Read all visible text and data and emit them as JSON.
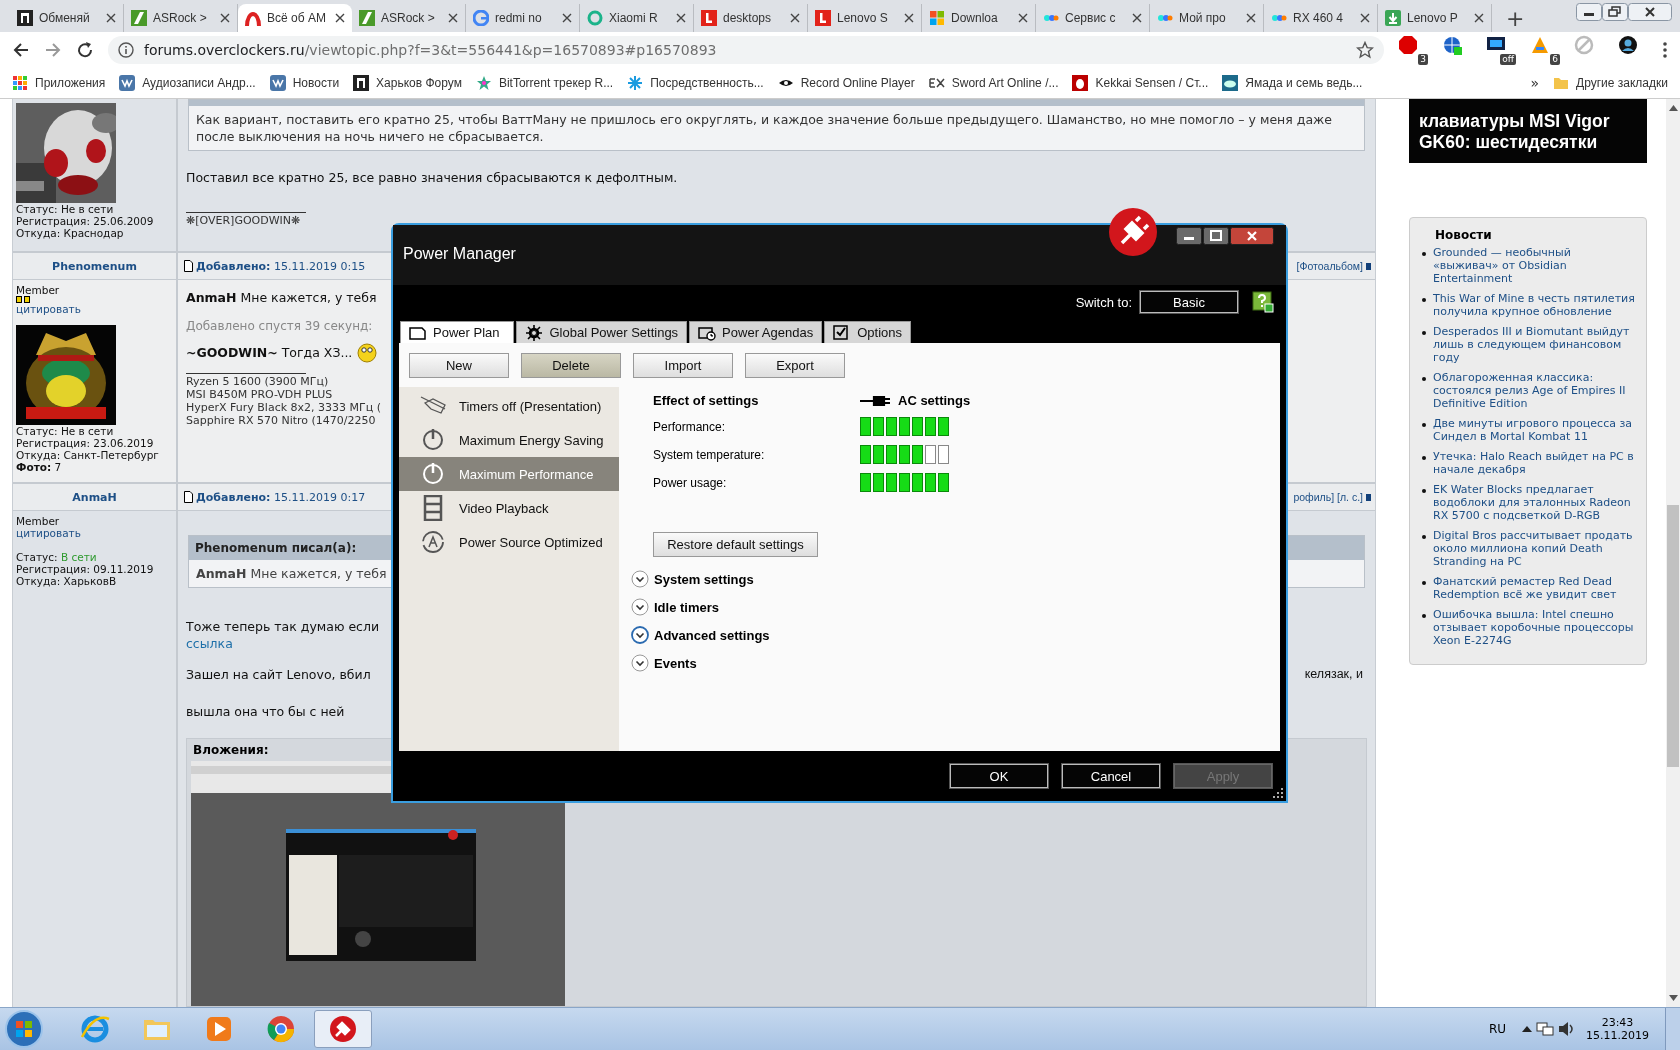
{
  "browser": {
    "tabs": [
      {
        "title": "Обменяй",
        "kind": "dark",
        "selected": false
      },
      {
        "title": "ASRock >",
        "kind": "green",
        "selected": false
      },
      {
        "title": "Всё об AM",
        "kind": "arc",
        "selected": true
      },
      {
        "title": "ASRock >",
        "kind": "green",
        "selected": false
      },
      {
        "title": "redmi no",
        "kind": "g",
        "selected": false
      },
      {
        "title": "Xiaomi R",
        "kind": "ring",
        "selected": false
      },
      {
        "title": "desktops",
        "kind": "red",
        "selected": false
      },
      {
        "title": "Lenovo S",
        "kind": "red",
        "selected": false
      },
      {
        "title": "Downloa",
        "kind": "win",
        "selected": false
      },
      {
        "title": "Сервис с",
        "kind": "dots",
        "selected": false
      },
      {
        "title": "Мой про",
        "kind": "dots",
        "selected": false
      },
      {
        "title": "RX 460 4",
        "kind": "dots",
        "selected": false
      },
      {
        "title": "Lenovo P",
        "kind": "down",
        "selected": false
      }
    ],
    "new_tab": "+",
    "address": {
      "domain": "forums.overclockers.ru",
      "path": "/viewtopic.php?f=3&t=556441&p=16570893#p16570893"
    },
    "extensions": [
      {
        "kind": "stop",
        "badge": "3"
      },
      {
        "kind": "globe"
      },
      {
        "kind": "monitor",
        "badge": "off"
      },
      {
        "kind": "a",
        "badge": "6"
      },
      {
        "kind": "grey"
      },
      {
        "kind": "avatar"
      }
    ],
    "bookmarks": [
      {
        "label": "Приложения",
        "kind": "grid"
      },
      {
        "label": "Аудиозаписи Андр...",
        "kind": "vk"
      },
      {
        "label": "Новости",
        "kind": "vk"
      },
      {
        "label": "Харьков Форум",
        "kind": "dark"
      },
      {
        "label": "BitTorrent трекер R...",
        "kind": "star"
      },
      {
        "label": "Посредственность...",
        "kind": "spark"
      },
      {
        "label": "Record Online Player",
        "kind": "eye"
      },
      {
        "label": "Sword Art Online /...",
        "kind": "ex"
      },
      {
        "label": "Kekkai Sensen / Ст...",
        "kind": "drop"
      },
      {
        "label": "Ямада и семь ведь...",
        "kind": "cloud"
      }
    ],
    "more": "»",
    "other_bookmarks": "Другие закладки"
  },
  "forum": {
    "posts": [
      {
        "user": {
          "fields": [
            {
              "label": "Статус:",
              "value": "Не в сети",
              "kind": "status",
              "online": false
            },
            {
              "label": "Регистрация:",
              "value": "25.06.2009",
              "kind": "plain"
            },
            {
              "label": "Откуда:",
              "value": "Краснодар",
              "kind": "plain"
            }
          ]
        },
        "body": [
          {
            "kind": "quote",
            "text": "Как вариант, поставить его кратно 25, чтобы ВаттМану не пришлось его округлять, и каждое значение больше предыдущего. Шаманство, но мне помогло – у меня даже после выключения на ночь ничего не сбрасывается."
          },
          {
            "kind": "para",
            "text": "Поставил все кратно 25, все равно значения сбрасываются к дефолтным."
          },
          {
            "kind": "signature",
            "lines": [
              "❋[OVER]GOODWIN❋"
            ]
          }
        ]
      },
      {
        "header": {
          "author": "Phenomenum",
          "date_label": "Добавлено:",
          "date": "15.11.2019 0:15",
          "links": "[Фотоальбом]"
        },
        "user": {
          "rank": "Member",
          "rank_badge": true,
          "quote_link": "цитировать",
          "fields": [
            {
              "label": "Статус:",
              "value": "Не в сети",
              "kind": "status",
              "online": false
            },
            {
              "label": "Регистрация:",
              "value": "23.06.2019",
              "kind": "plain"
            },
            {
              "label": "Откуда:",
              "value": "Санкт-Петербург",
              "kind": "plain"
            },
            {
              "label": "Фото:",
              "value": "7",
              "kind": "bold"
            }
          ]
        },
        "body": [
          {
            "kind": "big",
            "text": "**AnmaH** Мне кажется, у тебя"
          },
          {
            "kind": "added",
            "text": "Добавлено спустя 39 секунд:"
          },
          {
            "kind": "big",
            "text": "**~GOODWIN~** Тогда ХЗ...",
            "smiley": true
          },
          {
            "kind": "signature",
            "lines": [
              "Ryzen 5 1600 (3900 МГц)",
              "MSI B450M PRO-VDH PLUS",
              "HyperX Fury Black 8x2, 3333 МГц (",
              "Sapphire RX 570 Nitro (1470/2250"
            ]
          }
        ]
      },
      {
        "header": {
          "author": "AnmaH",
          "date_label": "Добавлено:",
          "date": "15.11.2019 0:17",
          "links": "рофиль] [л. с.]"
        },
        "user": {
          "rank": "Member",
          "quote_link": "цитировать",
          "fields": [
            {
              "label": "Статус:",
              "value": "В сети",
              "kind": "status",
              "online": true
            },
            {
              "label": "Регистрация:",
              "value": "09.11.2019",
              "kind": "plain"
            },
            {
              "label": "Откуда:",
              "value": "ХарьковВ",
              "kind": "plain"
            }
          ]
        },
        "body": [
          {
            "kind": "quote",
            "header": "Phenomenum писал(а):",
            "text": "**AnmaH** Мне кажется, у тебя"
          },
          {
            "kind": "para",
            "text": "Тоже теперь так думаю если"
          },
          {
            "kind": "link",
            "text": "ссылка"
          },
          {
            "kind": "split",
            "left": "Зашел на сайт Lenovo, вбил",
            "right": "келязак, и"
          },
          {
            "kind": "para",
            "text": "вышла она что бы с ней"
          },
          {
            "kind": "attachments",
            "title": "Вложения:"
          }
        ]
      }
    ]
  },
  "sidebar": {
    "banner": "клавиатуры MSI Vigor GK60: шестидесятки",
    "news": {
      "title": "Новости",
      "items": [
        "Grounded — необычный «выживач» от Obsidian Entertainment",
        "This War of Mine в честь пятилетия получила крупное обновление",
        "Desperados III и Biomutant выйдут лишь в следующем финансовом году",
        "Облагороженная классика: состоялся релиз Age of Empires II Definitive Edition",
        "Две минуты игрового процесса за Синдел в Mortal Kombat 11",
        "Утечка: Halo Reach выйдет на PC в начале декабря",
        "EK Water Blocks предлагает водоблоки для эталонных Radeon RX 5700 с подсветкой D-RGB",
        "Digital Bros рассчитывает продать около миллиона копий Death Stranding на PC",
        "Фанатский ремастер Red Dead Redemption всё же увидит свет",
        "Ошибочка вышла: Intel спешно отзывает коробочные процессоры Xeon E-2274G"
      ]
    }
  },
  "power_manager": {
    "title": "Power Manager",
    "switch_label": "Switch to:",
    "switch_button": "Basic",
    "tabs": [
      {
        "label": "Power Plan",
        "kind": "page",
        "selected": true
      },
      {
        "label": "Global Power Settings",
        "kind": "gear",
        "selected": false
      },
      {
        "label": "Power Agendas",
        "kind": "clock",
        "selected": false
      },
      {
        "label": "Options",
        "kind": "check",
        "selected": false
      }
    ],
    "actions": [
      {
        "label": "New",
        "highlighted": false
      },
      {
        "label": "Delete",
        "highlighted": true
      },
      {
        "label": "Import",
        "highlighted": false
      },
      {
        "label": "Export",
        "highlighted": false
      }
    ],
    "plans": [
      {
        "label": "Timers off (Presentation)",
        "kind": "projector",
        "selected": false
      },
      {
        "label": "Maximum Energy Saving",
        "kind": "power",
        "selected": false
      },
      {
        "label": "Maximum Performance",
        "kind": "power",
        "selected": true
      },
      {
        "label": "Video Playback",
        "kind": "film",
        "selected": false
      },
      {
        "label": "Power Source Optimized",
        "kind": "auto",
        "selected": false
      }
    ],
    "effect_title": "Effect of settings",
    "source_label": "AC settings",
    "meters": [
      {
        "label": "Performance:",
        "level": 1
      },
      {
        "label": "System temperature:",
        "level": 0.714
      },
      {
        "label": "Power usage:",
        "level": 1
      }
    ],
    "restore_button": "Restore default settings",
    "sections": [
      {
        "label": "System settings",
        "focused": false
      },
      {
        "label": "Idle timers",
        "focused": false
      },
      {
        "label": "Advanced settings",
        "focused": true
      },
      {
        "label": "Events",
        "focused": false
      }
    ],
    "buttons": [
      {
        "label": "OK",
        "disabled": false
      },
      {
        "label": "Cancel",
        "disabled": false
      },
      {
        "label": "Apply",
        "disabled": true
      }
    ]
  },
  "taskbar": {
    "apps": [
      {
        "kind": "ie",
        "active": false
      },
      {
        "kind": "folder",
        "active": false
      },
      {
        "kind": "media",
        "active": false
      },
      {
        "kind": "chrome",
        "active": false
      },
      {
        "kind": "plug",
        "active": true
      }
    ],
    "language": "RU",
    "time": "23:43",
    "date": "15.11.2019"
  }
}
